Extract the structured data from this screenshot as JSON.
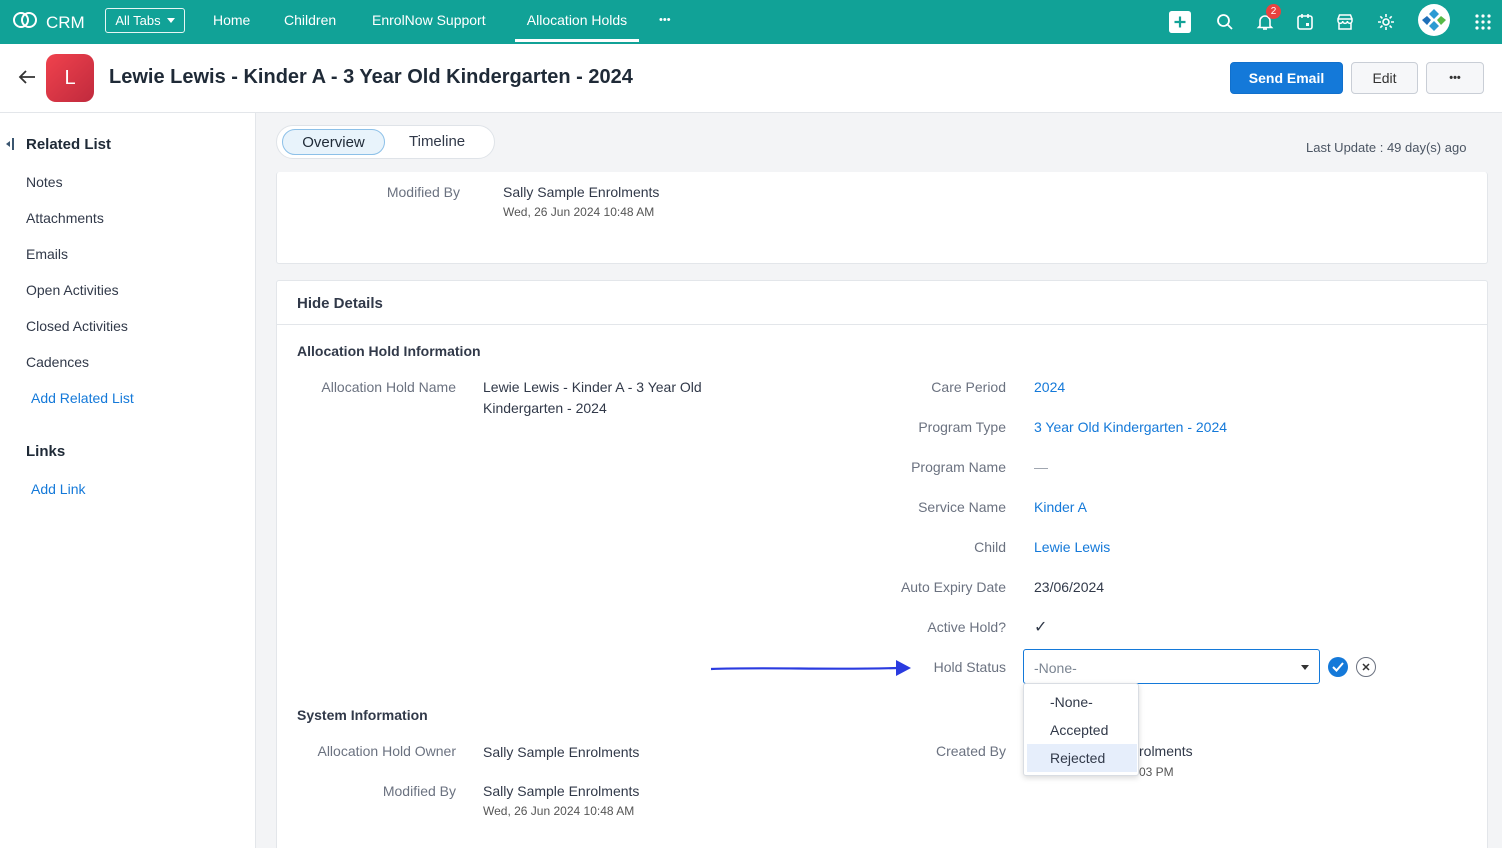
{
  "topbar": {
    "brand": "CRM",
    "all_tabs": "All Tabs",
    "nav": [
      "Home",
      "Children",
      "EnrolNow Support",
      "Allocation Holds"
    ],
    "more": "•••",
    "notification_count": "2"
  },
  "header": {
    "avatar_letter": "L",
    "title": "Lewie Lewis - Kinder A - 3 Year Old Kindergarten - 2024",
    "send_email": "Send Email",
    "edit": "Edit",
    "more": "•••"
  },
  "sidebar": {
    "related_heading": "Related List",
    "items": [
      "Notes",
      "Attachments",
      "Emails",
      "Open Activities",
      "Closed Activities",
      "Cadences"
    ],
    "add_related": "Add Related List",
    "links_heading": "Links",
    "add_link": "Add Link"
  },
  "tabs": {
    "overview": "Overview",
    "timeline": "Timeline"
  },
  "last_update": "Last Update : 49 day(s) ago",
  "top_card": {
    "modified_by_label": "Modified By",
    "modified_by": "Sally Sample Enrolments",
    "modified_time": "Wed, 26 Jun 2024 10:48 AM"
  },
  "details": {
    "hide_details": "Hide Details",
    "section_title": "Allocation Hold Information",
    "name_label": "Allocation Hold Name",
    "name_line1": "Lewie Lewis - Kinder A - 3 Year Old",
    "name_line2": "Kindergarten - 2024",
    "care_period_label": "Care Period",
    "care_period": "2024",
    "program_type_label": "Program Type",
    "program_type": "3 Year Old Kindergarten - 2024",
    "program_name_label": "Program Name",
    "program_name": "—",
    "service_name_label": "Service Name",
    "service_name": "Kinder A",
    "child_label": "Child",
    "child": "Lewie Lewis",
    "auto_expiry_label": "Auto Expiry Date",
    "auto_expiry": "23/06/2024",
    "active_hold_label": "Active Hold?",
    "active_hold": "✓",
    "hold_status_label": "Hold Status",
    "hold_status_value": "-None-",
    "hold_status_options": [
      "-None-",
      "Accepted",
      "Rejected"
    ]
  },
  "system": {
    "section_title": "System Information",
    "owner_label": "Allocation Hold Owner",
    "owner": "Sally Sample Enrolments",
    "created_by_label": "Created By",
    "created_by_partial": "rolments",
    "created_time_partial": "03 PM",
    "modified_by_label": "Modified By",
    "modified_by": "Sally Sample Enrolments",
    "modified_time": "Wed, 26 Jun 2024 10:48 AM"
  },
  "colors": {
    "topbar": "#11a297",
    "accent": "#1479d9",
    "annotation_arrow": "#2a3be0"
  }
}
